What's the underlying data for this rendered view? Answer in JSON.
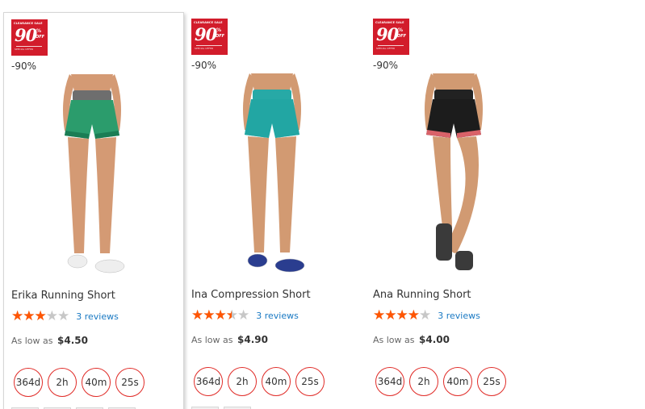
{
  "products": [
    {
      "badge": {
        "top": "CLEARANCE SALE",
        "number": "90",
        "pct": "%",
        "off": "OFF",
        "foot": "SPECIAL OFFER"
      },
      "discount": "-90%",
      "name": "Erika Running Short",
      "rating": 3,
      "rating_max": 5,
      "reviews": "3 reviews",
      "price_prefix": "As low as",
      "price": "$4.50",
      "timer": [
        "364d",
        "2h",
        "40m",
        "25s"
      ],
      "colors": {
        "waistband": "#6e6e6e",
        "short": "#2b9c6c",
        "pattern": "#1a7a52",
        "shoe": "#eeeeee",
        "skin": "#d49a74"
      },
      "active": true
    },
    {
      "badge": {
        "top": "CLEARANCE SALE",
        "number": "90",
        "pct": "%",
        "off": "OFF",
        "foot": "SPECIAL OFFER"
      },
      "discount": "-90%",
      "name": "Ina Compression Short",
      "rating": 3.5,
      "rating_max": 5,
      "reviews": "3 reviews",
      "price_prefix": "As low as",
      "price": "$4.90",
      "timer": [
        "364d",
        "2h",
        "40m",
        "25s"
      ],
      "colors": {
        "waistband": "#27a9a6",
        "short": "#22a6a3",
        "pattern": "#22a6a3",
        "shoe": "#2a3d8f",
        "skin": "#d29a72"
      },
      "active": false
    },
    {
      "badge": {
        "top": "CLEARANCE SALE",
        "number": "90",
        "pct": "%",
        "off": "OFF",
        "foot": "SPECIAL OFFER"
      },
      "discount": "-90%",
      "name": "Ana Running Short",
      "rating": 4,
      "rating_max": 5,
      "reviews": "3 reviews",
      "price_prefix": "As low as",
      "price": "$4.00",
      "timer": [
        "364d",
        "2h",
        "40m",
        "25s"
      ],
      "colors": {
        "waistband": "#222222",
        "short": "#1c1c1c",
        "pattern": "#ee6a72",
        "shoe": "#3a3a3a",
        "skin": "#d19a72"
      },
      "active": false
    }
  ],
  "colors": {
    "accent_red": "#e02b27",
    "star_fill": "#ff5501",
    "star_empty": "#c7c7c7",
    "link": "#1979c3",
    "badge_red": "#d21c2b"
  }
}
